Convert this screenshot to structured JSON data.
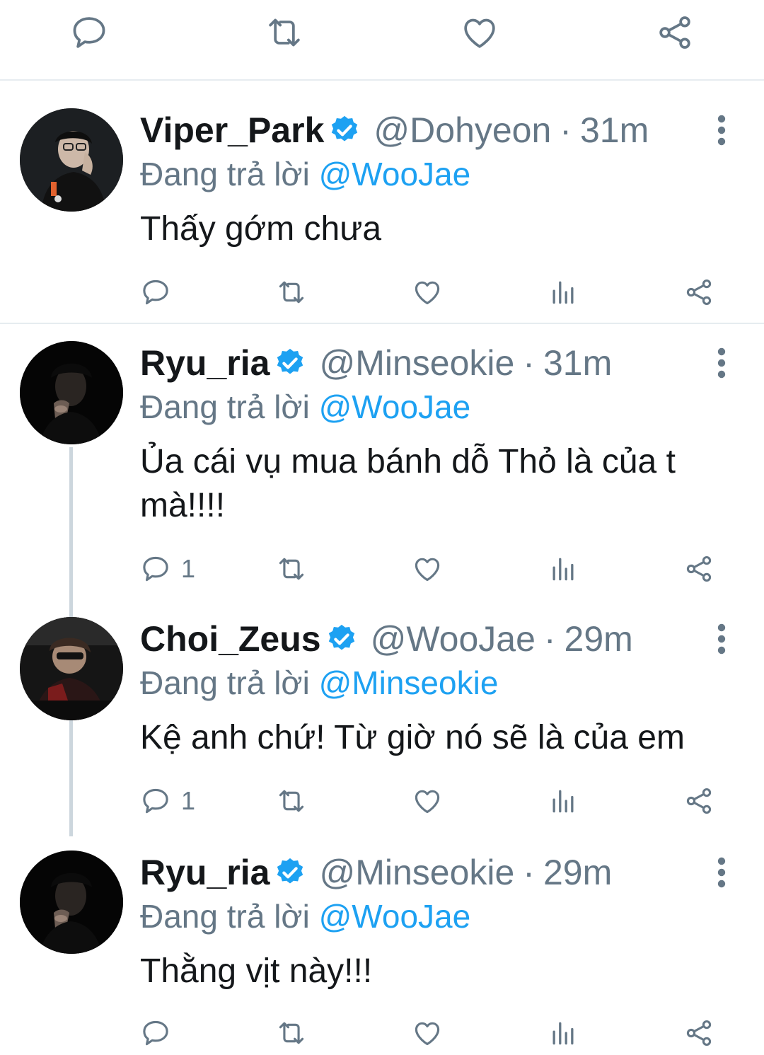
{
  "top_actions": {
    "reply_icon": "reply-icon",
    "retweet_icon": "retweet-icon",
    "like_icon": "like-icon",
    "share_icon": "share-icon"
  },
  "colors": {
    "text": "#14171a",
    "secondary": "#657786",
    "link": "#1da1f2",
    "verified": "#1da1f2",
    "divider": "#e6ecf0",
    "thread_line": "#ccd6dd"
  },
  "replying_prefix": "Đang trả lời",
  "tweets": [
    {
      "display_name": "Viper_Park",
      "handle": "@Dohyeon",
      "separator": "·",
      "time": "31m",
      "reply_to": "@WooJae",
      "text": "Thấy gớm chưa",
      "reply_count": ""
    },
    {
      "display_name": "Ryu_ria",
      "handle": "@Minseokie",
      "separator": "·",
      "time": "31m",
      "reply_to": "@WooJae",
      "text": "Ủa cái vụ mua bánh dỗ Thỏ là của t mà!!!!",
      "reply_count": "1"
    },
    {
      "display_name": "Choi_Zeus",
      "handle": "@WooJae",
      "separator": "·",
      "time": "29m",
      "reply_to": "@Minseokie",
      "text": "Kệ anh chứ! Từ giờ nó sẽ là của em",
      "reply_count": "1"
    },
    {
      "display_name": "Ryu_ria",
      "handle": "@Minseokie",
      "separator": "·",
      "time": "29m",
      "reply_to": "@WooJae",
      "text": "Thằng vịt này!!!",
      "reply_count": ""
    }
  ]
}
